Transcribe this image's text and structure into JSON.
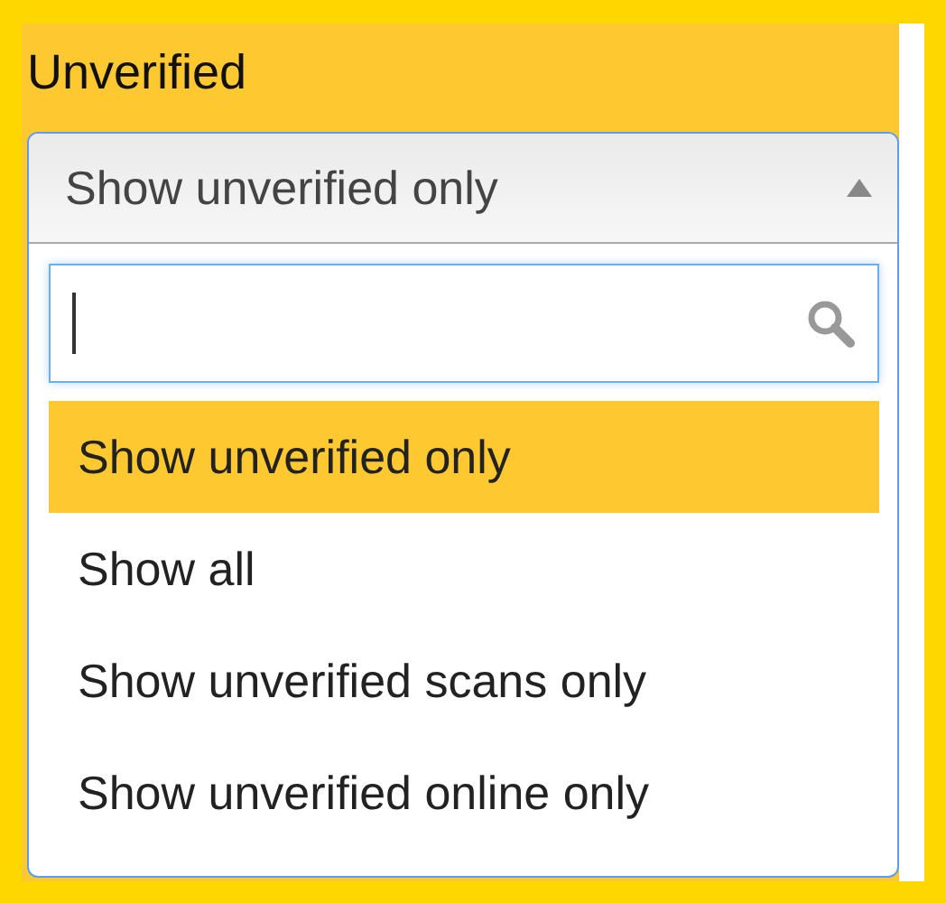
{
  "field_label": "Unverified",
  "select": {
    "value": "Show unverified only",
    "expanded": true
  },
  "options": [
    {
      "label": "Show unverified only",
      "selected": true
    },
    {
      "label": "Show all",
      "selected": false
    },
    {
      "label": "Show unverified scans only",
      "selected": false
    },
    {
      "label": "Show unverified online only",
      "selected": false
    }
  ]
}
